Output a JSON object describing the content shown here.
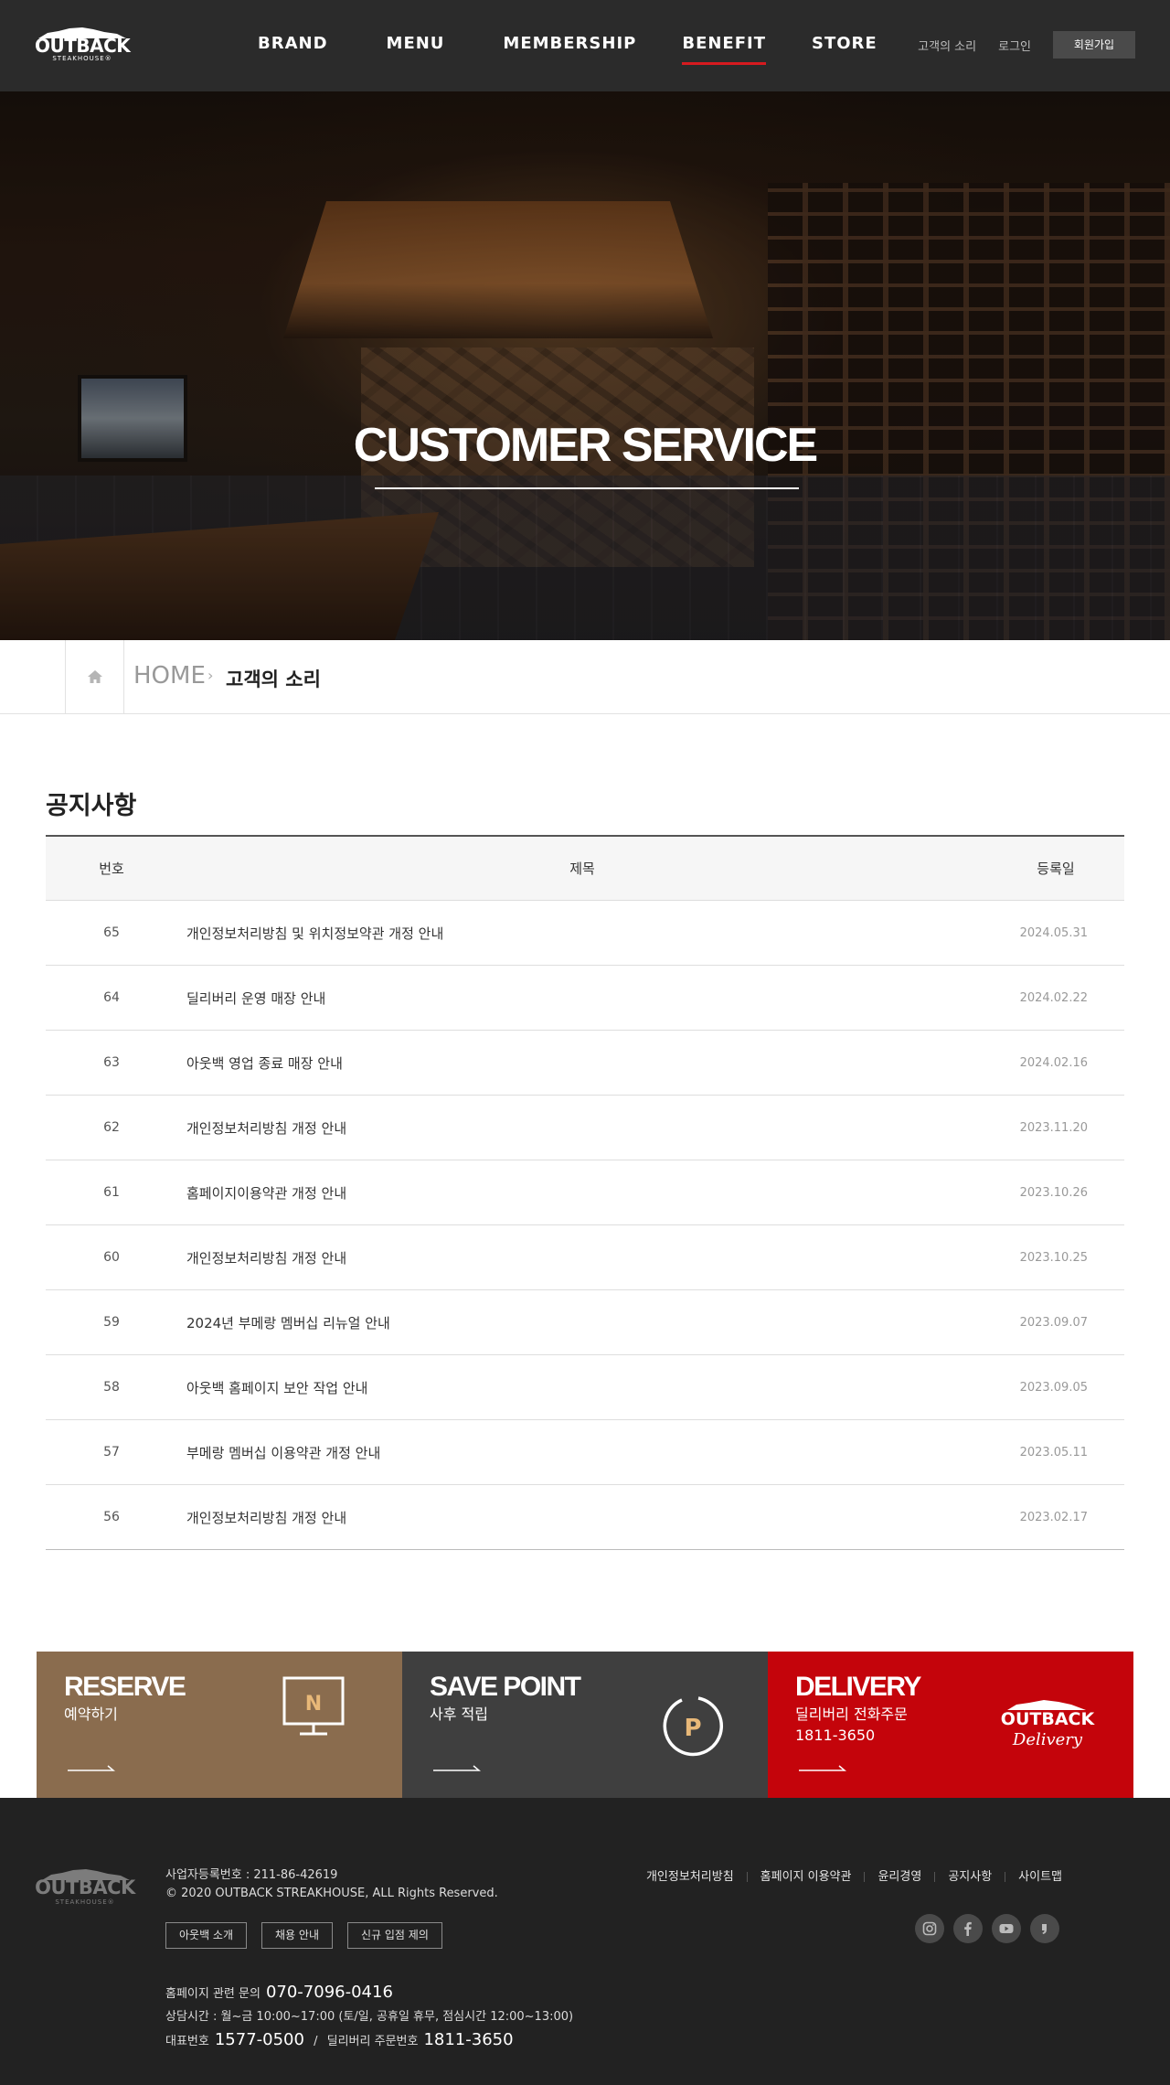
{
  "header": {
    "logo_text": "OUTBACK",
    "logo_sub": "STEAKHOUSE®",
    "nav": [
      {
        "label": "BRAND"
      },
      {
        "label": "MENU"
      },
      {
        "label": "MEMBERSHIP"
      },
      {
        "label": "BENEFIT"
      },
      {
        "label": "STORE"
      }
    ],
    "active_nav": "BENEFIT",
    "util": {
      "voice": "고객의 소리",
      "login": "로그인",
      "join": "회원가입"
    }
  },
  "hero": {
    "title": "CUSTOMER SERVICE"
  },
  "breadcrumb": {
    "root": "HOME",
    "current": "고객의 소리"
  },
  "notice": {
    "title": "공지사항",
    "columns": {
      "num": "번호",
      "subject": "제목",
      "date": "등록일"
    },
    "rows": [
      {
        "num": "65",
        "subject": "개인정보처리방침 및 위치정보약관 개정 안내",
        "date": "2024.05.31"
      },
      {
        "num": "64",
        "subject": "딜리버리 운영 매장 안내",
        "date": "2024.02.22"
      },
      {
        "num": "63",
        "subject": "아웃백 영업 종료 매장 안내",
        "date": "2024.02.16"
      },
      {
        "num": "62",
        "subject": "개인정보처리방침 개정 안내",
        "date": "2023.11.20"
      },
      {
        "num": "61",
        "subject": "홈페이지이용약관 개정 안내",
        "date": "2023.10.26"
      },
      {
        "num": "60",
        "subject": "개인정보처리방침 개정 안내",
        "date": "2023.10.25"
      },
      {
        "num": "59",
        "subject": "2024년 부메랑 멤버십 리뉴얼 안내",
        "date": "2023.09.07"
      },
      {
        "num": "58",
        "subject": "아웃백 홈페이지 보안 작업 안내",
        "date": "2023.09.05"
      },
      {
        "num": "57",
        "subject": "부메랑 멤버십 이용약관 개정 안내",
        "date": "2023.05.11"
      },
      {
        "num": "56",
        "subject": "개인정보처리방침 개정 안내",
        "date": "2023.02.17"
      }
    ]
  },
  "banners": {
    "reserve": {
      "title": "RESERVE",
      "sub": "예약하기",
      "icon_letter": "N",
      "color": "#8a6c4e"
    },
    "point": {
      "title": "SAVE POINT",
      "sub": "사후 적립",
      "icon_letter": "P",
      "color": "#3f3f3f"
    },
    "delivery": {
      "title": "DELIVERY",
      "sub1": "딜리버리 전화주문",
      "sub2": "1811-3650",
      "logo_text": "OUTBACK",
      "logo_script": "Delivery",
      "color": "#c4040b"
    }
  },
  "footer": {
    "logo_text": "OUTBACK",
    "logo_sub": "STEAKHOUSE®",
    "biz_no": "사업자등록번호 : 211-86-42619",
    "copyright": "© 2020 OUTBACK STREAKHOUSE, ALL Rights Reserved.",
    "buttons": [
      "아웃백 소개",
      "채용 안내",
      "신규 입점 제의"
    ],
    "inquiry_label": "홈페이지 관련 문의",
    "inquiry_number": "070-7096-0416",
    "hours": "상담시간 : 월~금 10:00~17:00 (토/일, 공휴일 휴무, 점심시간 12:00~13:00)",
    "rep_label": "대표번호",
    "rep_number": "1577-0500",
    "slash": "/",
    "delivery_label": "딜리버리 주문번호",
    "delivery_number": "1811-3650",
    "links": [
      "개인정보처리방침",
      "홈페이지 이용약관",
      "윤리경영",
      "공지사항",
      "사이트맵"
    ],
    "sns": [
      "instagram-icon",
      "facebook-icon",
      "youtube-icon",
      "blog-icon"
    ]
  }
}
